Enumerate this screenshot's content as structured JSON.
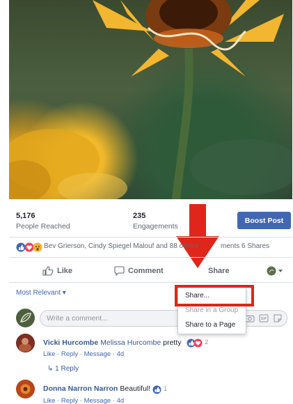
{
  "stats": {
    "reach_value": "5,176",
    "reach_label": "People Reached",
    "engagement_value": "235",
    "engagement_label": "Engagements",
    "boost_label": "Boost Post"
  },
  "reactions": {
    "names": "Bev Grierson, Cindy Spiegel Malouf and 88 others",
    "right": "ments  6 Shares"
  },
  "actions": {
    "like": "Like",
    "comment": "Comment",
    "share": "Share"
  },
  "sort_label": "Most Relevant ▾",
  "write_placeholder": "Write a comment...",
  "share_menu": {
    "items": [
      "Share...",
      "Share in a Group",
      "Share to a Page"
    ]
  },
  "comments": [
    {
      "name": "Vicki Hurcombe",
      "tag": "Melissa Hurcombe",
      "text": "pretty",
      "reaction_count": "2",
      "meta": "Like · Reply · Message · 4d",
      "replies": "↳ 1 Reply"
    },
    {
      "name": "Donna Narron Narron",
      "text": "Beautiful!",
      "reaction_count": "1",
      "meta": "Like · Reply · Message · 4d"
    }
  ],
  "colors": {
    "facebook_blue": "#4267b2",
    "highlight_red": "#e0251b",
    "name_blue": "#385898"
  }
}
